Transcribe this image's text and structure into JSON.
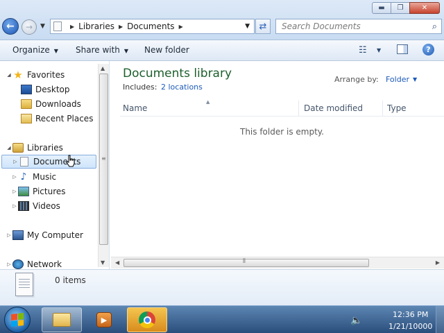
{
  "window": {
    "controls": {
      "minimize": "▬",
      "maximize": "❐",
      "close": "✕"
    }
  },
  "nav": {
    "back_glyph": "←",
    "forward_glyph": "→",
    "recent_glyph": "▼"
  },
  "address": {
    "crumbs": [
      "Libraries",
      "Documents"
    ],
    "separator": "▶",
    "dropdown_glyph": "▼",
    "refresh_glyph": "⇄"
  },
  "search": {
    "placeholder": "Search Documents",
    "icon": "⌕"
  },
  "toolbar": {
    "organize": "Organize",
    "share_with": "Share with",
    "new_folder": "New folder",
    "caret": "▼",
    "views_icon": "☷",
    "help": "?"
  },
  "sidebar": {
    "expanded_glyph": "◢",
    "collapsed_glyph": "▷",
    "favorites": {
      "label": "Favorites",
      "items": [
        "Desktop",
        "Downloads",
        "Recent Places"
      ]
    },
    "libraries": {
      "label": "Libraries",
      "items": [
        "Documents",
        "Music",
        "Pictures",
        "Videos"
      ],
      "selected": "Documents"
    },
    "computer": "My Computer",
    "network": "Network",
    "music_icon": "♪"
  },
  "main": {
    "title": "Documents library",
    "includes_label": "Includes:",
    "locations_link": "2 locations",
    "arrange_label": "Arrange by:",
    "arrange_value": "Folder",
    "columns": [
      "Name",
      "Date modified",
      "Type"
    ],
    "sort_glyph": "▲",
    "empty_message": "This folder is empty."
  },
  "details": {
    "item_count": "0 items"
  },
  "scroll": {
    "up": "▲",
    "down": "▼",
    "left": "◀",
    "right": "▶",
    "grip_v": "≡",
    "grip_h": "⦀"
  },
  "taskbar": {
    "time": "12:36 PM",
    "date": "1/21/10000",
    "volume_icon": "🔈",
    "media_glyph": "▶"
  },
  "colors": {
    "title_green": "#1c5f2c",
    "link_blue": "#1c5ab9",
    "selection": "#cfe5fb"
  }
}
